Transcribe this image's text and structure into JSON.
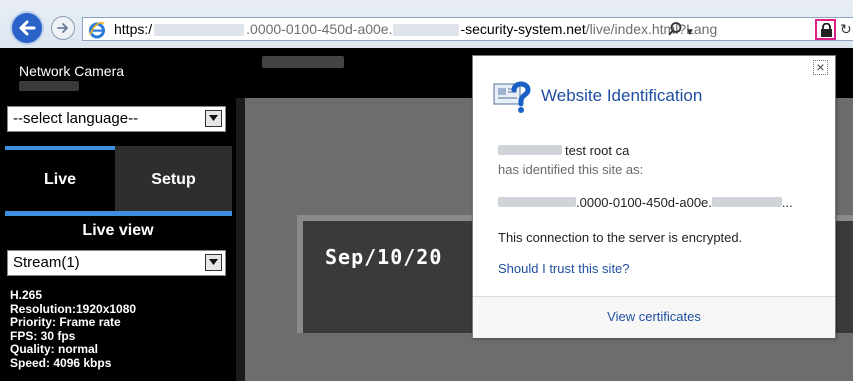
{
  "browser": {
    "url": {
      "scheme": "https:/",
      "host_mid": ".0000-0100-450d-a00e.",
      "host_end": "-security-system.net",
      "path": "/live/index.html?Lang"
    },
    "accent_color": "#2a62c8"
  },
  "camera": {
    "title": "Network Camera",
    "language_select": {
      "selected": "--select language--"
    },
    "tabs": [
      {
        "label": "Live",
        "active": true
      },
      {
        "label": "Setup",
        "active": false
      }
    ],
    "live_view_label": "Live view",
    "stream_select": {
      "selected": "Stream(1)"
    },
    "stream_info": [
      "H.265",
      "Resolution:1920x1080",
      "Priority: Frame rate",
      "FPS: 30 fps",
      "Quality: normal",
      "Speed:  4096 kbps"
    ],
    "video_timestamp": "Sep/10/20",
    "accent_color": "#3e8fe0"
  },
  "popup": {
    "close_symbol": "×",
    "title": "Website Identification",
    "issuer": "test root ca",
    "identified_text": "has identified this site as:",
    "site_mid": ".0000-0100-450d-a00e.",
    "site_suffix": "...",
    "encrypted_text": "This connection to the server is encrypted.",
    "trust_link": "Should I trust this site?",
    "view_certificates": "View certificates",
    "link_color": "#1f4fa0"
  }
}
